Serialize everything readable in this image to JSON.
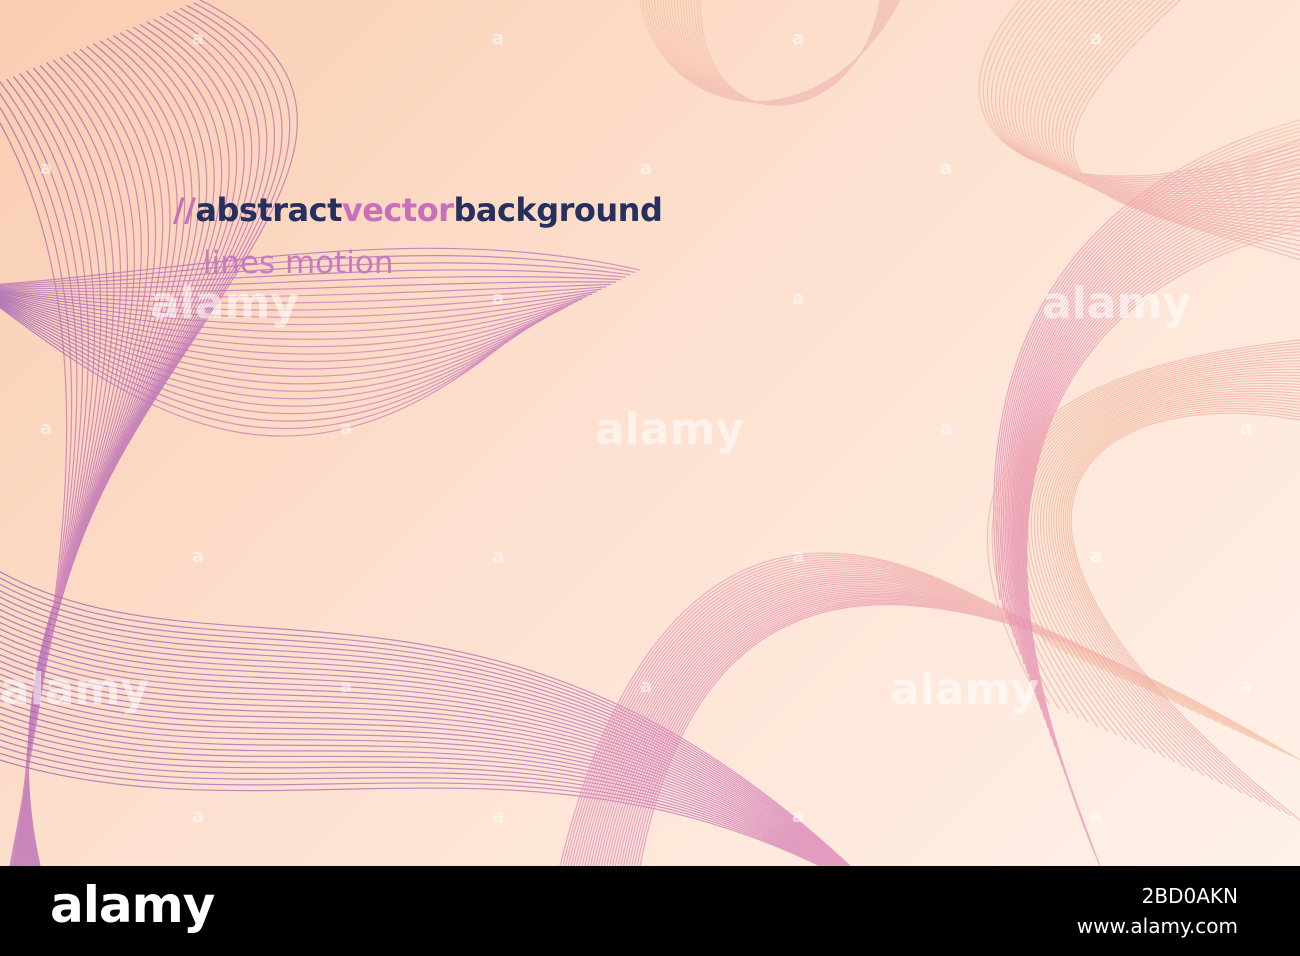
{
  "headline": {
    "prefix": "//",
    "word1": "abstract",
    "word2": "vector",
    "word3": "background"
  },
  "subheadline": "lines motion",
  "watermark": {
    "large": "alamy",
    "small": "a"
  },
  "footer": {
    "logo": "alamy",
    "image_id": "2BD0AKN",
    "url": "www.alamy.com"
  },
  "colors": {
    "navy": "#26305e",
    "pink": "#c86fb9",
    "line_purple": "#a468b8",
    "line_pink": "#e389b8",
    "line_peach": "#f3b89b",
    "background_top": "#f9cdb0",
    "background_bottom": "#fff1e8"
  }
}
